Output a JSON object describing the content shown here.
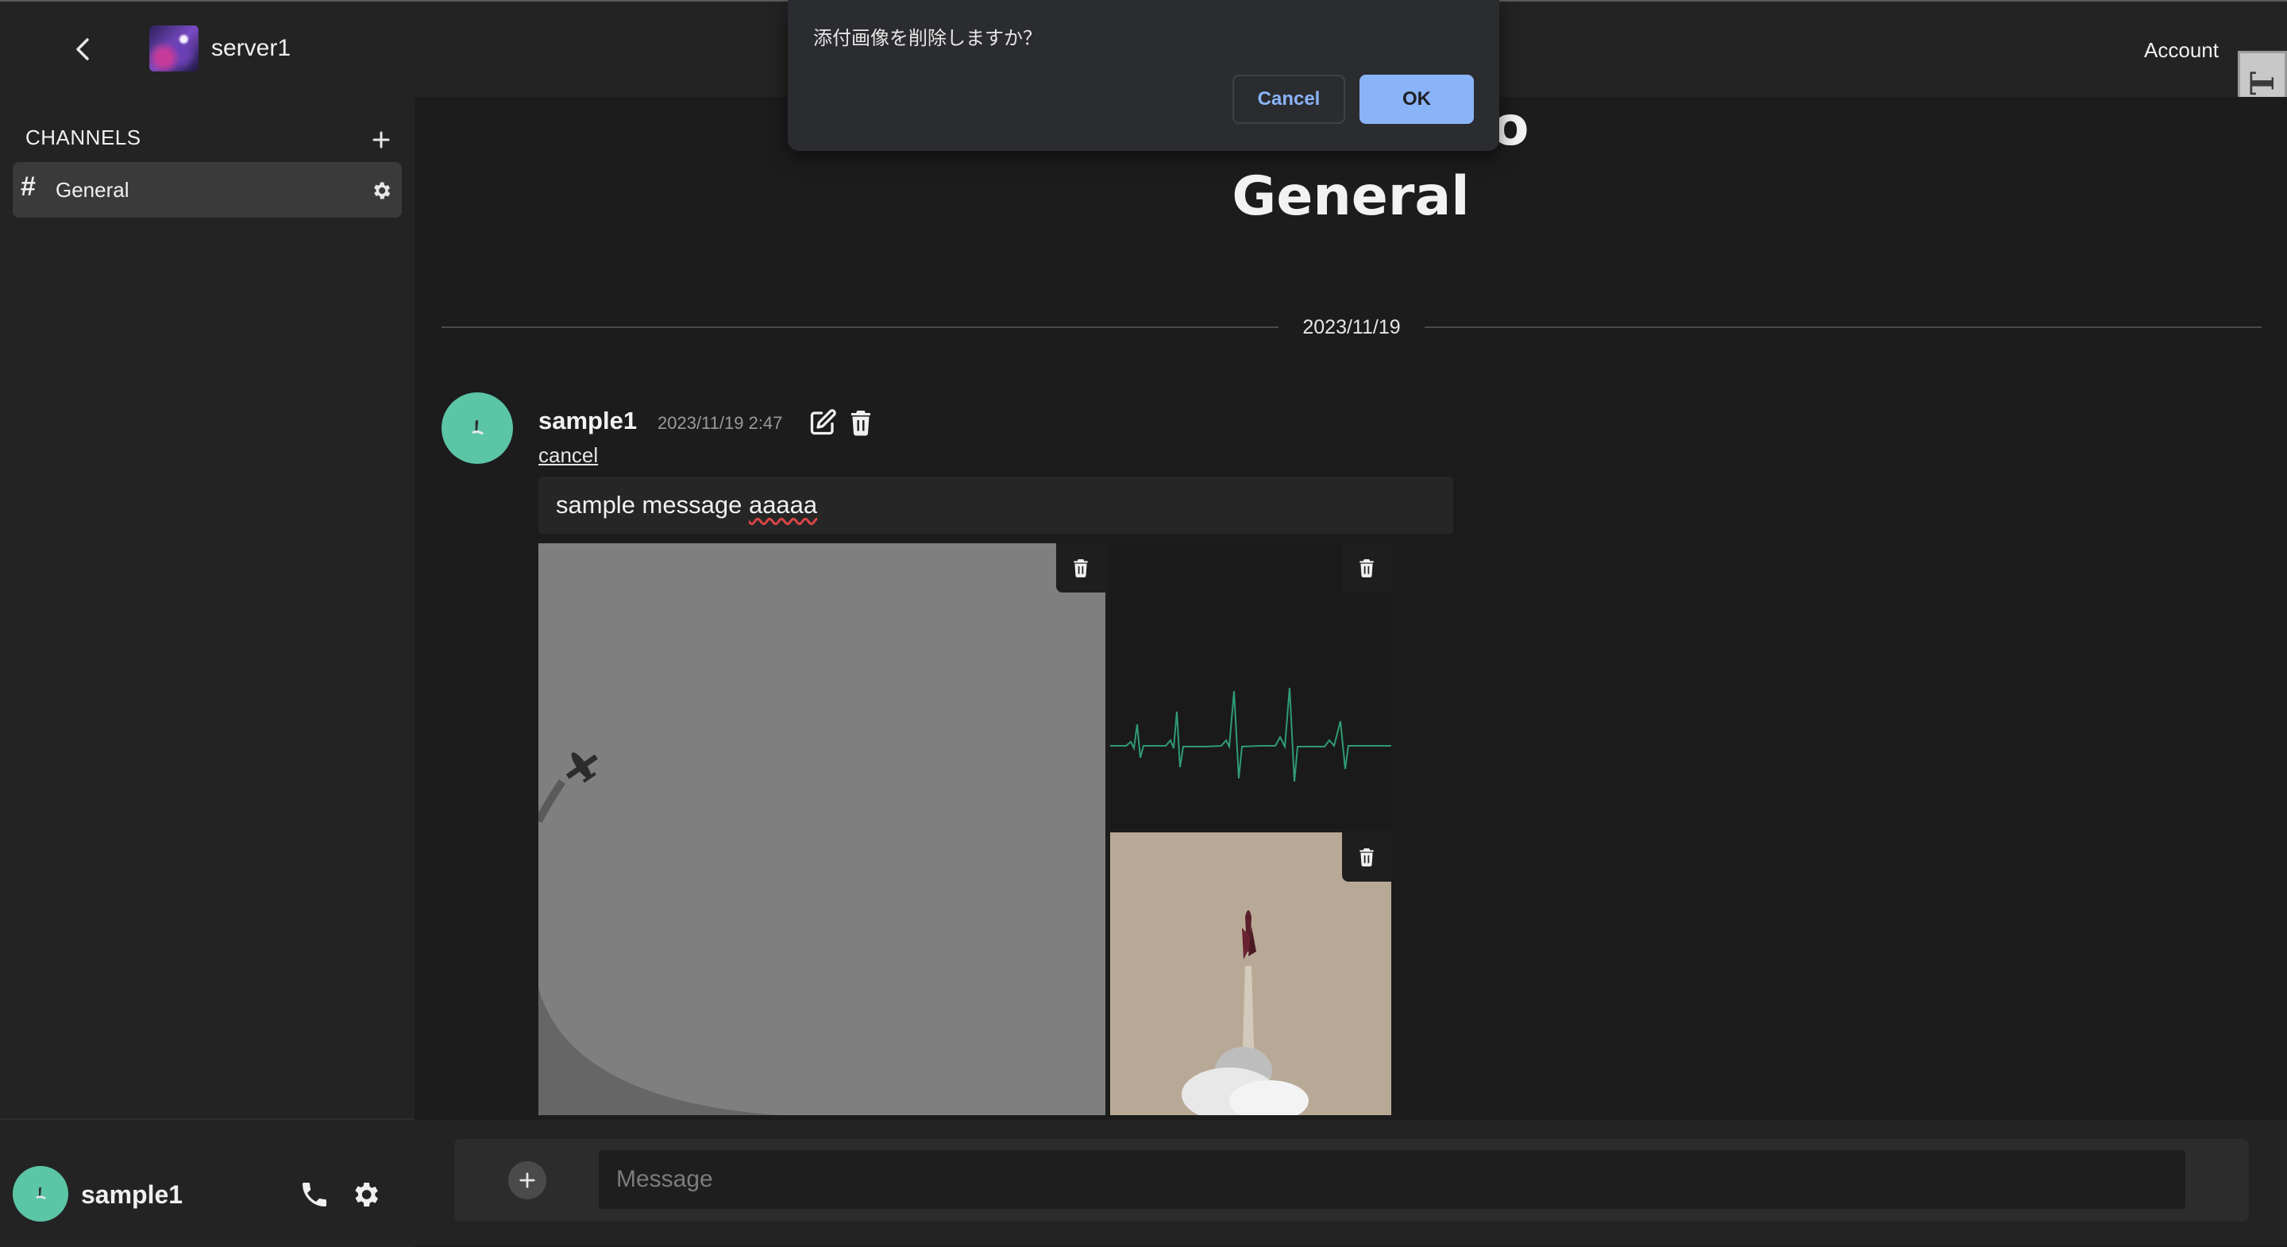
{
  "header": {
    "server_name": "server1",
    "account_label": "Account",
    "badge_text": "EDT"
  },
  "dialog": {
    "message": "添付画像を削除しますか？",
    "cancel_label": "Cancel",
    "ok_label": "OK"
  },
  "sidebar": {
    "section_label": "CHANNELS",
    "channels": [
      {
        "hash": "#",
        "name": "General"
      }
    ]
  },
  "current_user": {
    "name": "sample1"
  },
  "main": {
    "welcome_line1": "Welcome to",
    "welcome_line2": "General",
    "date_separator": "2023/11/19",
    "message": {
      "author": "sample1",
      "timestamp": "2023/11/19 2:47",
      "cancel_label": "cancel",
      "edit_text_prefix": "sample message ",
      "edit_text_misspelled": "aaaaa",
      "attachments": [
        {
          "type": "image",
          "subject": "plane"
        },
        {
          "type": "image",
          "subject": "ekg"
        },
        {
          "type": "image",
          "subject": "rocket"
        }
      ]
    }
  },
  "composer": {
    "placeholder": "Message"
  },
  "colors": {
    "accent_blue": "#8ab4f8",
    "avatar_teal": "#5cc5a6",
    "background": "#1c1c1c",
    "panel": "#232323"
  }
}
